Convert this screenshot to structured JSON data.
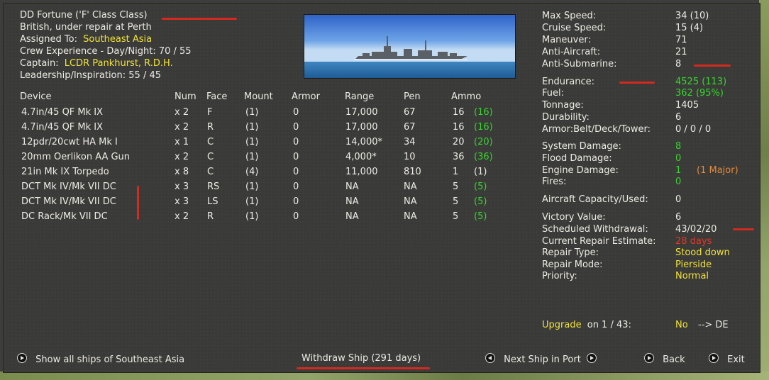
{
  "header": {
    "ship_name": "DD Fortune ('F' Class Class)",
    "status": "British, under repair at Perth",
    "assigned_label": "Assigned To:",
    "assigned_value": "Southeast Asia",
    "crew_exp": "Crew Experience - Day/Night: 70 / 55",
    "captain_label": "Captain:",
    "captain_value": "LCDR Pankhurst, R.D.H.",
    "leadership": "Leadership/Inspiration: 55 / 45"
  },
  "devices": {
    "columns": [
      "Device",
      "Num",
      "Face",
      "Mount",
      "Armor",
      "Range",
      "Pen",
      "Ammo"
    ],
    "rows": [
      {
        "device": "4.7in/45 QF Mk IX",
        "num": "x 2",
        "face": "F",
        "mount": "(1)",
        "armor": "0",
        "range": "17,000",
        "pen": "67",
        "ammo": "16",
        "ammo_max": "(16)",
        "ammo_color": "green"
      },
      {
        "device": "4.7in/45 QF Mk IX",
        "num": "x 2",
        "face": "R",
        "mount": "(1)",
        "armor": "0",
        "range": "17,000",
        "pen": "67",
        "ammo": "16",
        "ammo_max": "(16)",
        "ammo_color": "green"
      },
      {
        "device": "12pdr/20cwt HA Mk I",
        "num": "x 1",
        "face": "C",
        "mount": "(1)",
        "armor": "0",
        "range": "14,000*",
        "pen": "34",
        "ammo": "20",
        "ammo_max": "(20)",
        "ammo_color": "green"
      },
      {
        "device": "20mm Oerlikon AA Gun",
        "num": "x 2",
        "face": "C",
        "mount": "(1)",
        "armor": "0",
        "range": "4,000*",
        "pen": "10",
        "ammo": "36",
        "ammo_max": "(36)",
        "ammo_color": "green"
      },
      {
        "device": "21in Mk IX Torpedo",
        "num": "x 8",
        "face": "C",
        "mount": "(4)",
        "armor": "0",
        "range": "11,000",
        "pen": "810",
        "ammo": "1",
        "ammo_max": "(1)",
        "ammo_color": "white"
      },
      {
        "device": "DCT Mk IV/Mk VII DC",
        "num": "x 3",
        "face": "RS",
        "mount": "(1)",
        "armor": "0",
        "range": "NA",
        "pen": "NA",
        "ammo": "5",
        "ammo_max": "(5)",
        "ammo_color": "green"
      },
      {
        "device": "DCT Mk IV/Mk VII DC",
        "num": "x 3",
        "face": "LS",
        "mount": "(1)",
        "armor": "0",
        "range": "NA",
        "pen": "NA",
        "ammo": "5",
        "ammo_max": "(5)",
        "ammo_color": "green"
      },
      {
        "device": "DC Rack/Mk VII DC",
        "num": "x 2",
        "face": "R",
        "mount": "(1)",
        "armor": "0",
        "range": "NA",
        "pen": "NA",
        "ammo": "5",
        "ammo_max": "(5)",
        "ammo_color": "green"
      }
    ]
  },
  "stats": {
    "max_speed": {
      "label": "Max Speed:",
      "value": "34 (10)"
    },
    "cruise_speed": {
      "label": "Cruise Speed:",
      "value": "15 (4)"
    },
    "maneuver": {
      "label": "Maneuver:",
      "value": "71"
    },
    "anti_aircraft": {
      "label": "Anti-Aircraft:",
      "value": "21"
    },
    "anti_submarine": {
      "label": "Anti-Submarine:",
      "value": "8"
    },
    "endurance": {
      "label": "Endurance:",
      "value": "4525 (113)"
    },
    "fuel": {
      "label": "Fuel:",
      "value": "362 (95%)"
    },
    "tonnage": {
      "label": "Tonnage:",
      "value": "1405"
    },
    "durability": {
      "label": "Durability:",
      "value": "6"
    },
    "armor": {
      "label": "Armor:Belt/Deck/Tower:",
      "value": "0 / 0 / 0"
    },
    "system_damage": {
      "label": "System Damage:",
      "value": "8"
    },
    "flood_damage": {
      "label": "Flood Damage:",
      "value": "0"
    },
    "engine_damage": {
      "label": "Engine Damage:",
      "value": "1",
      "extra": "(1 Major)"
    },
    "fires": {
      "label": "Fires:",
      "value": "0"
    },
    "aircraft_capacity": {
      "label": "Aircraft Capacity/Used:",
      "value": "0"
    },
    "victory_value": {
      "label": "Victory Value:",
      "value": "6"
    },
    "scheduled_withdrawal": {
      "label": "Scheduled Withdrawal:",
      "value": "43/02/20"
    },
    "repair_estimate": {
      "label": "Current Repair Estimate:",
      "value": "28 days"
    },
    "repair_type": {
      "label": "Repair Type:",
      "value": "Stood down"
    },
    "repair_mode": {
      "label": "Repair Mode:",
      "value": "Pierside"
    },
    "priority": {
      "label": "Priority:",
      "value": "Normal"
    }
  },
  "upgrade": {
    "label": "Upgrade",
    "on_text": "on 1 / 43:",
    "value": "No",
    "target": "--> DE"
  },
  "buttons": {
    "show_all": "Show all ships of Southeast Asia",
    "withdraw": "Withdraw Ship (291 days)",
    "next_ship": "Next Ship in Port",
    "back": "Back",
    "exit": "Exit"
  },
  "colors": {
    "panel_bg": "#3a3a38",
    "text": "#ecebe4",
    "yellow": "#f1e23a",
    "green": "#36d62e",
    "red": "#e0382b",
    "orange": "#e68a3a",
    "annotation": "#d32a20"
  }
}
